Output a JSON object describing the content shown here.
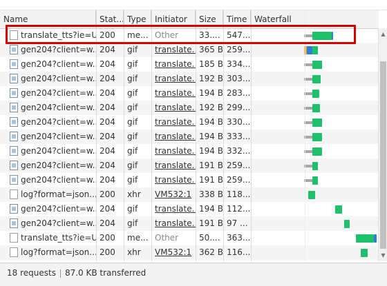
{
  "headers": {
    "name": "Name",
    "status": "Stat...",
    "type": "Type",
    "initiator": "Initiator",
    "size": "Size",
    "time": "Time",
    "waterfall": "Waterfall"
  },
  "rows": [
    {
      "name": "translate_tts?ie=U...",
      "status": "200",
      "type": "me...",
      "initiator": "Other",
      "size": "33....",
      "time": "547...",
      "icon": "doc"
    },
    {
      "name": "gen204?client=w...",
      "status": "204",
      "type": "gif",
      "initiator": "translate...",
      "size": "365 B",
      "time": "259...",
      "icon": "img"
    },
    {
      "name": "gen204?client=w...",
      "status": "204",
      "type": "gif",
      "initiator": "translate...",
      "size": "185 B",
      "time": "334...",
      "icon": "img"
    },
    {
      "name": "gen204?client=w...",
      "status": "204",
      "type": "gif",
      "initiator": "translate...",
      "size": "192 B",
      "time": "303...",
      "icon": "img"
    },
    {
      "name": "gen204?client=w...",
      "status": "204",
      "type": "gif",
      "initiator": "translate...",
      "size": "194 B",
      "time": "283...",
      "icon": "img"
    },
    {
      "name": "gen204?client=w...",
      "status": "204",
      "type": "gif",
      "initiator": "translate...",
      "size": "192 B",
      "time": "299...",
      "icon": "img"
    },
    {
      "name": "gen204?client=w...",
      "status": "204",
      "type": "gif",
      "initiator": "translate...",
      "size": "194 B",
      "time": "330...",
      "icon": "img"
    },
    {
      "name": "gen204?client=w...",
      "status": "204",
      "type": "gif",
      "initiator": "translate...",
      "size": "194 B",
      "time": "333...",
      "icon": "img"
    },
    {
      "name": "gen204?client=w...",
      "status": "204",
      "type": "gif",
      "initiator": "translate...",
      "size": "194 B",
      "time": "332...",
      "icon": "img"
    },
    {
      "name": "gen204?client=w...",
      "status": "204",
      "type": "gif",
      "initiator": "translate...",
      "size": "191 B",
      "time": "259...",
      "icon": "img"
    },
    {
      "name": "gen204?client=w...",
      "status": "204",
      "type": "gif",
      "initiator": "translate...",
      "size": "191 B",
      "time": "259...",
      "icon": "img"
    },
    {
      "name": "log?format=json...",
      "status": "200",
      "type": "xhr",
      "initiator": "VM532:1",
      "size": "338 B",
      "time": "118...",
      "icon": "doc"
    },
    {
      "name": "gen204?client=w...",
      "status": "204",
      "type": "gif",
      "initiator": "translate...",
      "size": "194 B",
      "time": "112...",
      "icon": "img"
    },
    {
      "name": "gen204?client=w...",
      "status": "204",
      "type": "gif",
      "initiator": "translate...",
      "size": "191 B",
      "time": "97 ...",
      "icon": "img"
    },
    {
      "name": "translate_tts?ie=U...",
      "status": "200",
      "type": "me...",
      "initiator": "Other",
      "size": "50....",
      "time": "363...",
      "icon": "doc"
    },
    {
      "name": "log?format=json...",
      "status": "200",
      "type": "xhr",
      "initiator": "VM532:1",
      "size": "362 B",
      "time": "116...",
      "icon": "doc"
    }
  ],
  "status_bar": {
    "requests": "18 requests",
    "transferred": "87.0 KB transferred"
  },
  "colors": {
    "waiting": "#a6a6a6",
    "download": "#1fc06b",
    "stalled": "#f0a040",
    "connect": "#2c7fd8",
    "highlight": "#d40000"
  }
}
